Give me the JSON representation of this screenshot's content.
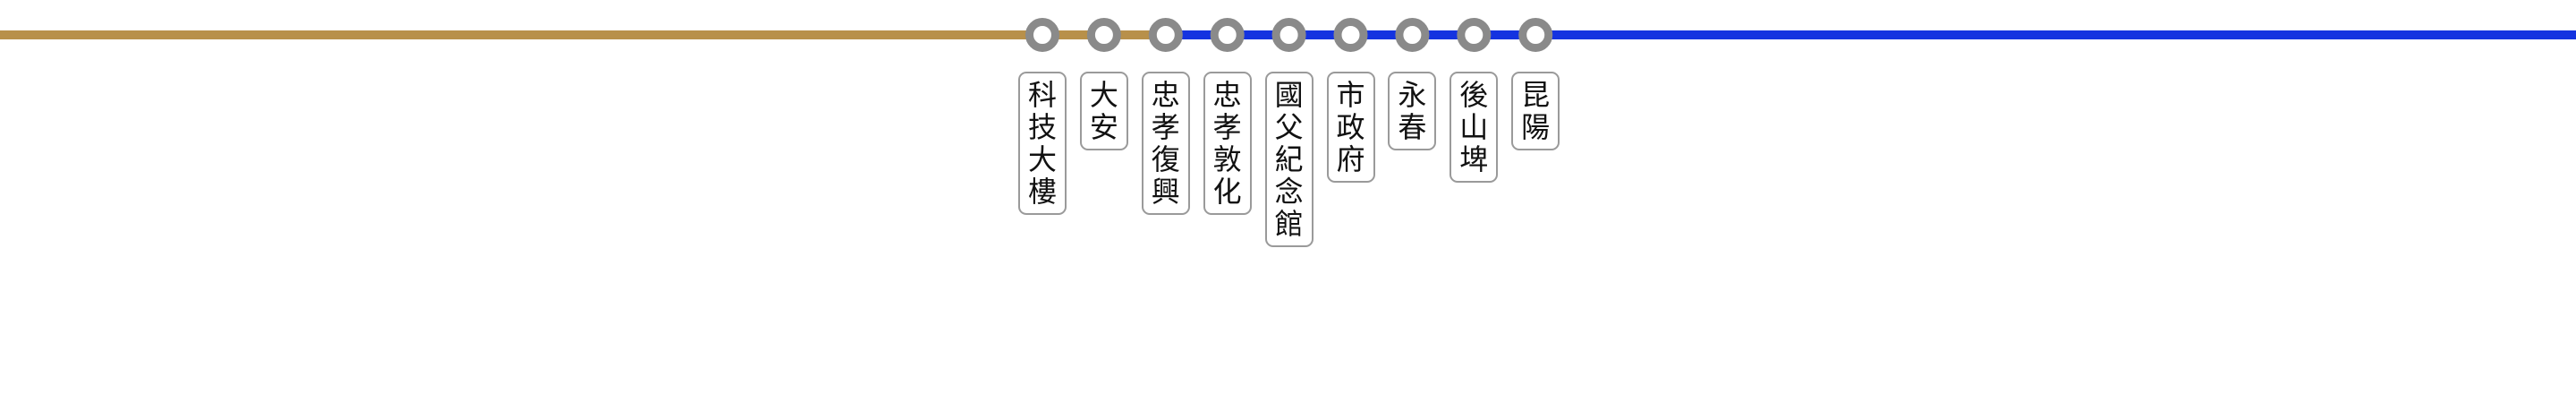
{
  "lines": [
    {
      "name": "",
      "color": "#B8904A",
      "from_station": 0,
      "to_station": 4,
      "extends_left": true
    },
    {
      "name": "",
      "color": "#1433E0",
      "from_station": 2,
      "to_station": 8,
      "extends_right": true
    }
  ],
  "station_marker": {
    "ring_color": "#8A8A8A",
    "fill_color": "#FFFFFF"
  },
  "stations": [
    {
      "name": "科技大樓"
    },
    {
      "name": "大安"
    },
    {
      "name": "忠孝復興"
    },
    {
      "name": "忠孝敦化"
    },
    {
      "name": "國父紀念館"
    },
    {
      "name": "市政府"
    },
    {
      "name": "永春"
    },
    {
      "name": "後山埤"
    },
    {
      "name": "昆陽"
    }
  ]
}
